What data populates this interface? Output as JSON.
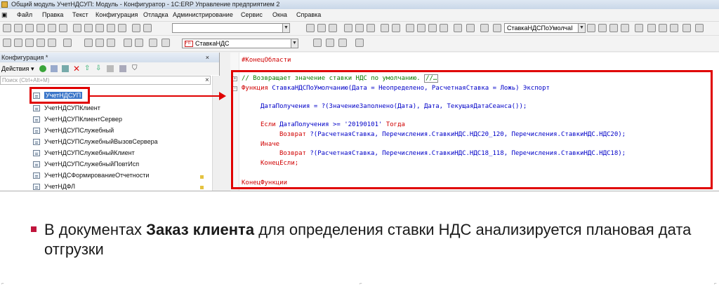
{
  "window": {
    "title": "Общий модуль УчетНДСУП: Модуль - Конфигуратор - 1С:ERP Управление предприятием 2"
  },
  "menu": [
    "Файл",
    "Правка",
    "Текст",
    "Конфигурация",
    "Отладка",
    "Администрирование",
    "Сервис",
    "Окна",
    "Справка"
  ],
  "toolbar": {
    "search_value": "СтавкаНДСПоУмолчаI",
    "procedure_combo": "СтавкаНДС"
  },
  "config_panel": {
    "title": "Конфигурация *",
    "actions_label": "Действия",
    "search_placeholder": "Поиск (Ctrl+Alt+M)",
    "items": [
      {
        "label": "УчетНДСУП",
        "selected": true
      },
      {
        "label": "УчетНДСУПКлиент"
      },
      {
        "label": "УчетНДСУПКлиентСервер"
      },
      {
        "label": "УчетНДСУПСлужебный"
      },
      {
        "label": "УчетНДСУПСлужебныйВызовСервера"
      },
      {
        "label": "УчетНДСУПСлужебныйКлиент"
      },
      {
        "label": "УчетНДСУПСлужебныйПовтИсп"
      },
      {
        "label": "УчетНДСФормированиеОтчетности"
      },
      {
        "label": "УчетНДФЛ"
      }
    ]
  },
  "code": {
    "end_region": "#КонецОбласти",
    "comment": "// Возвращает значение ставки НДС по умолчанию.",
    "comment_ellipsis": "//…",
    "func_kw": "Функция",
    "func_sig": "СтавкаНДСПоУмолчанию(Дата = Неопределено, РасчетнаяСтавка = Ложь) Экспорт",
    "line_assign": "ДатаПолучения = ?(ЗначениеЗаполнено(Дата), Дата, ТекущаяДатаСеанса());",
    "if_kw": "Если",
    "if_cond": "ДатаПолучения >= '20190101'",
    "then_kw": "Тогда",
    "ret_kw": "Возврат",
    "ret1": "?(РасчетнаяСтавка, Перечисления.СтавкиНДС.НДС20_120, Перечисления.СтавкиНДС.НДС20);",
    "else_kw": "Иначе",
    "ret2": "?(РасчетнаяСтавка, Перечисления.СтавкиНДС.НДС18_118, Перечисления.СтавкиНДС.НДС18);",
    "endif_kw": "КонецЕсли;",
    "endfunc_kw": "КонецФункции"
  },
  "slide": {
    "text_before": "В документах ",
    "text_bold": "Заказ клиента",
    "text_after": " для определения ставки НДС анализируется плановая дата отгрузки"
  },
  "colors": {
    "accent_red": "#e00000",
    "bullet": "#c0143c",
    "selection": "#3b76c9"
  }
}
